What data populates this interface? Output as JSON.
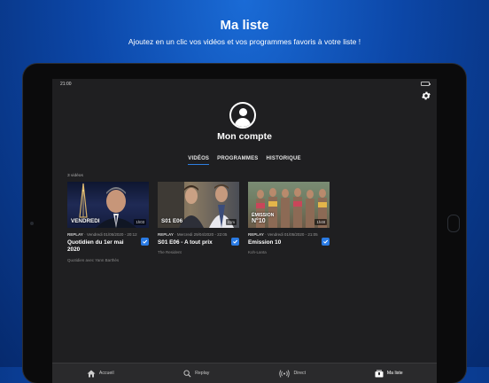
{
  "promo": {
    "title": "Ma liste",
    "subtitle": "Ajoutez en un clic vos vidéos et vos programmes favoris à votre liste !"
  },
  "status_bar": {
    "time": "21:00"
  },
  "icons": {
    "settings": "gear-icon",
    "account": "user-icon",
    "selected": "check-icon",
    "home": "home-icon",
    "replay": "search-icon",
    "live": "broadcast-icon",
    "my_list": "bookmark-icon"
  },
  "account": {
    "title": "Mon compte"
  },
  "tabs": [
    {
      "label": "VIDÉOS",
      "active": true
    },
    {
      "label": "PROGRAMMES",
      "active": false
    },
    {
      "label": "HISTORIQUE",
      "active": false
    }
  ],
  "video_count": "3 vidéos",
  "videos": [
    {
      "thumb_label_1": "VENDREDI",
      "thumb_label_2": "",
      "duration": "1h03",
      "type": "REPLAY",
      "date": " · Vendredi 01/05/2020 - 20:12",
      "title": "Quotidien du 1er mai 2020",
      "subtitle": "Quotidien avec Yann Barthès",
      "checked": true
    },
    {
      "thumb_label_1": "S01 E06",
      "thumb_label_2": "",
      "duration": "41m",
      "type": "REPLAY",
      "date": " · Mercredi 29/04/2020 - 22:05",
      "title": "S01 E06 - A tout prix",
      "subtitle": "The Resident",
      "checked": true
    },
    {
      "thumb_label_1": "ÉMISSION",
      "thumb_label_2": "N°10",
      "duration": "1h48",
      "type": "REPLAY",
      "date": " · Vendredi 01/05/2020 - 21:05",
      "title": "Emission 10",
      "subtitle": "Koh-Lanta",
      "checked": true
    }
  ],
  "tabbar": [
    {
      "label": "Accueil",
      "icon": "home-icon",
      "active": false
    },
    {
      "label": "Replay",
      "icon": "search-icon",
      "active": false
    },
    {
      "label": "Direct",
      "icon": "broadcast-icon",
      "active": false
    },
    {
      "label": "Ma liste",
      "icon": "bookmark-icon",
      "active": true
    }
  ],
  "colors": {
    "background": "#0c47a8",
    "accent": "#2a7be4",
    "screen": "#1f1f21"
  }
}
